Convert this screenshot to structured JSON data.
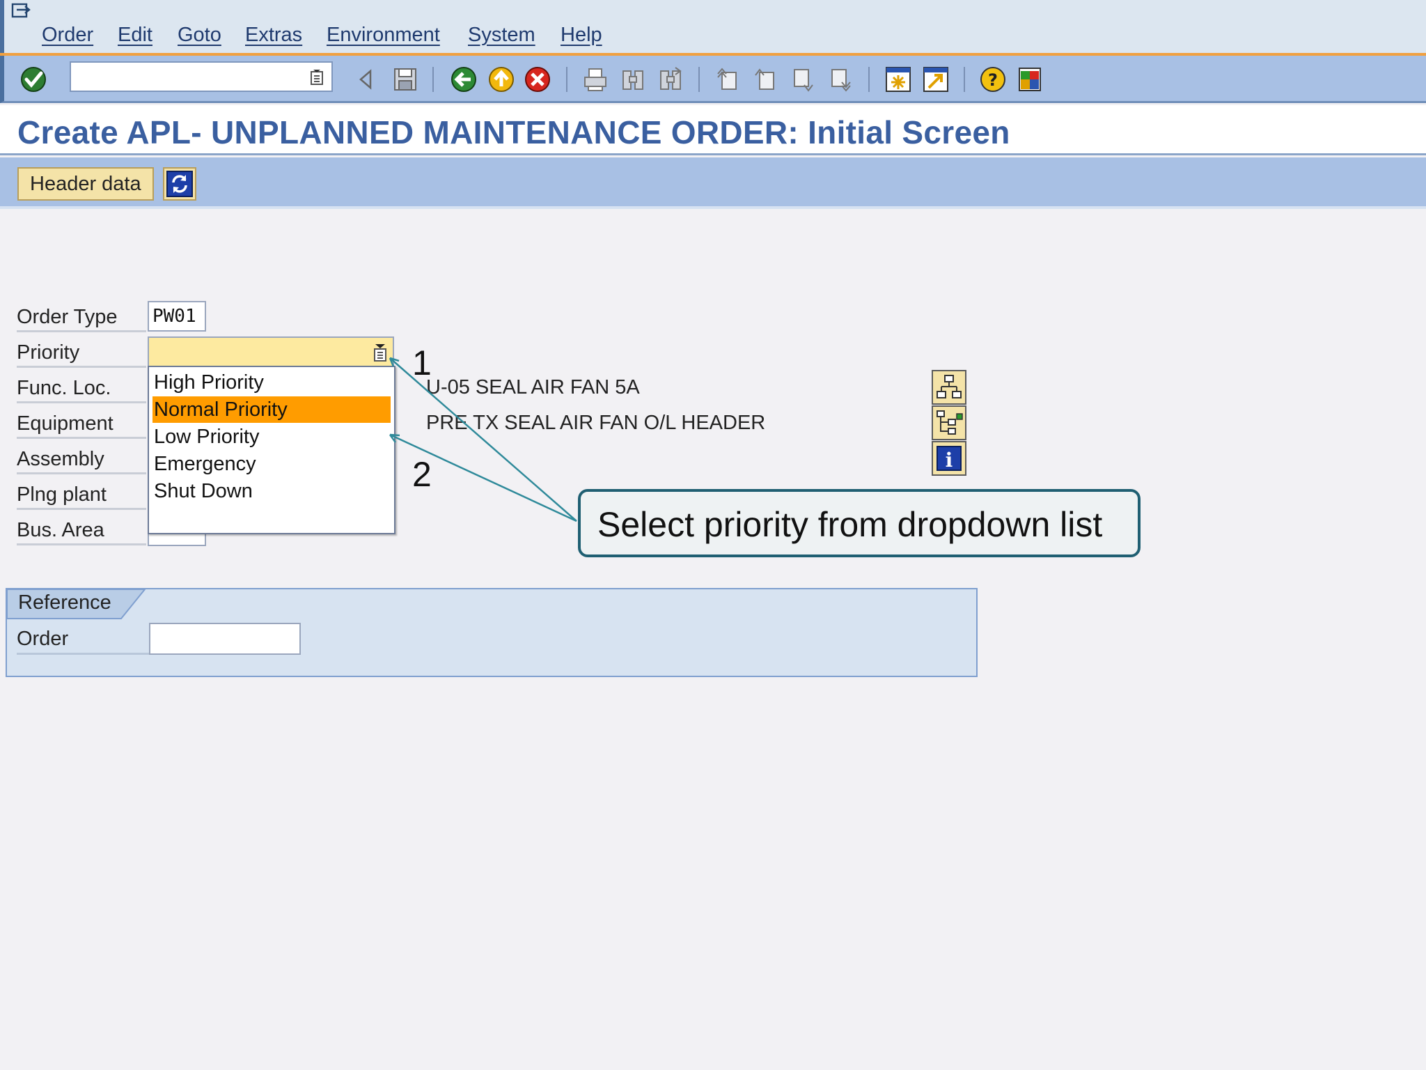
{
  "menu": {
    "items": [
      "Order",
      "Edit",
      "Goto",
      "Extras",
      "Environment",
      "System",
      "Help"
    ]
  },
  "toolbar": {
    "command_field_value": "",
    "icons": [
      "enter-icon",
      "command-menu-icon",
      "back-arrow-icon",
      "save-icon",
      "back-icon",
      "exit-icon",
      "cancel-icon",
      "print-icon",
      "find-icon",
      "find-next-icon",
      "first-page-icon",
      "previous-page-icon",
      "next-page-icon",
      "last-page-icon",
      "create-session-icon",
      "shortcut-icon",
      "help-icon",
      "layout-menu-icon"
    ]
  },
  "title": "Create APL- UNPLANNED MAINTENANCE ORDER: Initial Screen",
  "app_toolbar": {
    "header_data_label": "Header data",
    "refresh_icon": "refresh-icon"
  },
  "form": {
    "order_type_label": "Order Type",
    "order_type_value": "PW01",
    "priority_label": "Priority",
    "priority_value": "",
    "func_loc_label": "Func. Loc.",
    "func_loc_desc": "U-05 SEAL AIR FAN 5A",
    "equipment_label": "Equipment",
    "equipment_desc": "PRE TX SEAL AIR FAN O/L HEADER",
    "assembly_label": "Assembly",
    "plng_plant_label": "Plng plant",
    "bus_area_label": "Bus. Area"
  },
  "dropdown": {
    "options": [
      "High Priority",
      "Normal Priority",
      "Low Priority",
      "Emergency",
      "Shut Down"
    ],
    "selected": "Normal Priority"
  },
  "side_buttons": [
    "structure-icon",
    "hierarchy-icon",
    "info-icon"
  ],
  "annotations": {
    "marker_1": "1",
    "marker_2": "2",
    "callout": "Select priority from dropdown list",
    "arrow_color": "#2f8a9a"
  },
  "reference": {
    "title": "Reference",
    "order_label": "Order",
    "order_value": ""
  },
  "colors": {
    "accent_orange": "#ff9c00",
    "toolbar_blue": "#a8c0e4",
    "title_blue": "#3a5fa0",
    "required_field_yellow": "#fdeaa0"
  }
}
